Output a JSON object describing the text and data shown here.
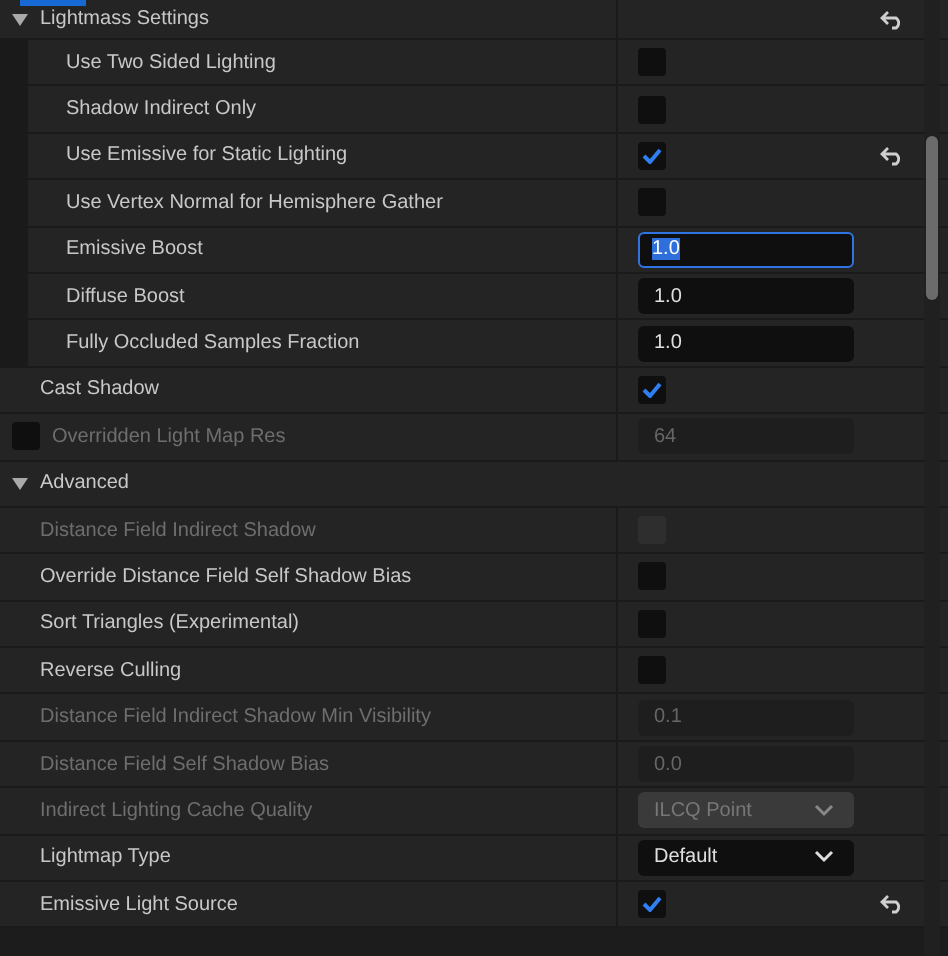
{
  "rows": [
    {
      "kind": "group",
      "label": "Lightmass Settings",
      "expanded": true,
      "reset": true,
      "children": [
        {
          "kind": "checkbox",
          "label": "Use Two Sided Lighting",
          "checked": false,
          "disabled": false,
          "reset": false
        },
        {
          "kind": "checkbox",
          "label": "Shadow Indirect Only",
          "checked": false,
          "disabled": false,
          "reset": false
        },
        {
          "kind": "checkbox",
          "label": "Use Emissive for Static Lighting",
          "checked": true,
          "disabled": false,
          "reset": true
        },
        {
          "kind": "checkbox",
          "label": "Use Vertex Normal for Hemisphere Gather",
          "checked": false,
          "disabled": false,
          "reset": false
        },
        {
          "kind": "number",
          "label": "Emissive Boost",
          "value": "1.0",
          "disabled": false,
          "focused": true
        },
        {
          "kind": "number",
          "label": "Diffuse Boost",
          "value": "1.0",
          "disabled": false,
          "focused": false
        },
        {
          "kind": "number",
          "label": "Fully Occluded Samples Fraction",
          "value": "1.0",
          "disabled": false,
          "focused": false
        }
      ]
    },
    {
      "kind": "checkbox",
      "label": "Cast Shadow",
      "checked": true,
      "disabled": false,
      "reset": false
    },
    {
      "kind": "number",
      "label": "Overridden Light Map Res",
      "value": "64",
      "disabled": true,
      "focused": false,
      "toggle": {
        "checked": false
      }
    },
    {
      "kind": "category",
      "label": "Advanced",
      "expanded": true,
      "children": [
        {
          "kind": "checkbox",
          "label": "Distance Field Indirect Shadow",
          "checked": false,
          "disabled": true,
          "reset": false
        },
        {
          "kind": "checkbox",
          "label": "Override Distance Field Self Shadow Bias",
          "checked": false,
          "disabled": false,
          "reset": false
        },
        {
          "kind": "checkbox",
          "label": "Sort Triangles (Experimental)",
          "checked": false,
          "disabled": false,
          "reset": false
        },
        {
          "kind": "checkbox",
          "label": "Reverse Culling",
          "checked": false,
          "disabled": false,
          "reset": false
        },
        {
          "kind": "number",
          "label": "Distance Field Indirect Shadow Min Visibility",
          "value": "0.1",
          "disabled": true,
          "focused": false
        },
        {
          "kind": "number",
          "label": "Distance Field Self Shadow Bias",
          "value": "0.0",
          "disabled": true,
          "focused": false
        },
        {
          "kind": "dropdown",
          "label": "Indirect Lighting Cache Quality",
          "value": "ILCQ Point",
          "disabled": true
        },
        {
          "kind": "dropdown",
          "label": "Lightmap Type",
          "value": "Default",
          "disabled": false
        },
        {
          "kind": "checkbox",
          "label": "Emissive Light Source",
          "checked": true,
          "disabled": false,
          "reset": true
        }
      ]
    }
  ]
}
